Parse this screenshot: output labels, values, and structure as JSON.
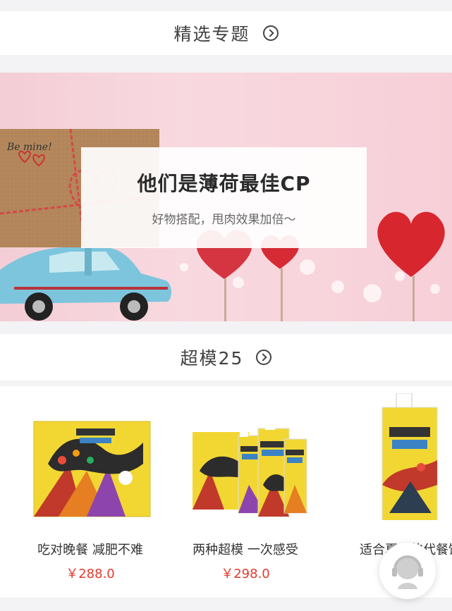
{
  "featured": {
    "title": "精选专题"
  },
  "banner": {
    "title": "他们是薄荷最佳CP",
    "subtitle": "好物搭配，甩肉效果加倍～",
    "gift_text": "Be mine!"
  },
  "brand_section": {
    "title": "超模25"
  },
  "products": [
    {
      "name": "吃对晚餐 减肥不难",
      "price": "￥288.0"
    },
    {
      "name": "两种超模 一次感受",
      "price": "￥298.0"
    },
    {
      "name": "适合夏天的代餐饮",
      "price": ""
    }
  ],
  "colors": {
    "price": "#e53a2c",
    "product_yellow": "#f2d733"
  },
  "icons": {
    "section_arrow": "chevron-right-circle-icon",
    "service": "customer-service-icon"
  }
}
